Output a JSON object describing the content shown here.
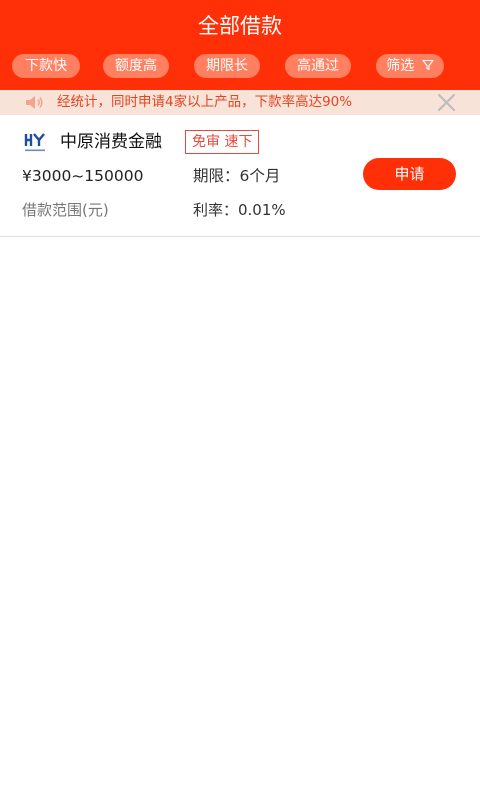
{
  "header": {
    "title": "全部借款",
    "background_color": "#ff3008",
    "filters": [
      {
        "label": "下款快"
      },
      {
        "label": "额度高"
      },
      {
        "label": "期限长"
      },
      {
        "label": "高通过"
      },
      {
        "label": "筛选",
        "icon": "funnel-icon"
      }
    ]
  },
  "notice": {
    "icon": "speaker-icon",
    "text": "经统计，同时申请4家以上产品，下款率高达90%",
    "close_icon": "close-icon"
  },
  "products": [
    {
      "logo_icon": "zhongyuan-logo",
      "name": "中原消费金融",
      "tag": "免审 速下",
      "amount_range": "¥3000~150000",
      "amount_label": "借款范围(元)",
      "term": "期限：6个月",
      "rate": "利率：0.01%",
      "apply_label": "申请",
      "accent_color": "#ff3008"
    }
  ]
}
